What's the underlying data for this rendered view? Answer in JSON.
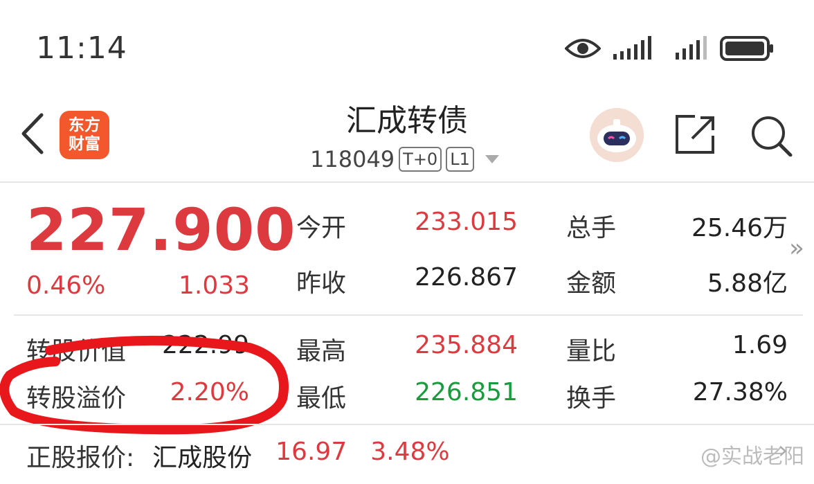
{
  "status_bar": {
    "time": "11:14"
  },
  "header": {
    "logo_line1": "东方",
    "logo_line2": "财富",
    "title": "汇成转债",
    "code": "118049",
    "tag1": "T+0",
    "tag2": "L1"
  },
  "quote": {
    "price": "227.900",
    "change_pct": "0.46%",
    "change_amt": "1.033",
    "stats": [
      {
        "label": "今开",
        "value": "233.015",
        "color": "#dc3a3f"
      },
      {
        "label": "昨收",
        "value": "226.867",
        "color": "#222222"
      },
      {
        "label": "最高",
        "value": "235.884",
        "color": "#dc3a3f"
      },
      {
        "label": "最低",
        "value": "226.851",
        "color": "#1a9b3e"
      }
    ],
    "stats_right": [
      {
        "label": "总手",
        "value": "25.46万"
      },
      {
        "label": "金额",
        "value": "5.88亿"
      },
      {
        "label": "量比",
        "value": "1.69"
      },
      {
        "label": "换手",
        "value": "27.38%"
      }
    ],
    "conv_value_label": "转股价值",
    "conv_value": "222.99",
    "conv_premium_label": "转股溢价",
    "conv_premium": "2.20%"
  },
  "footer": {
    "label": "正股报价:",
    "stock_name": "汇成股份",
    "stock_price": "16.97",
    "stock_pct": "3.48%",
    "watermark": "@实战老阳"
  },
  "colors": {
    "up": "#dc3a3f",
    "down": "#1a9b3e",
    "brand": "#f2582b"
  },
  "icons": [
    "eye-icon",
    "signal-icon",
    "battery-icon",
    "back-icon",
    "share-icon",
    "search-icon",
    "chevron-double-right-icon",
    "chevron-right-icon"
  ]
}
